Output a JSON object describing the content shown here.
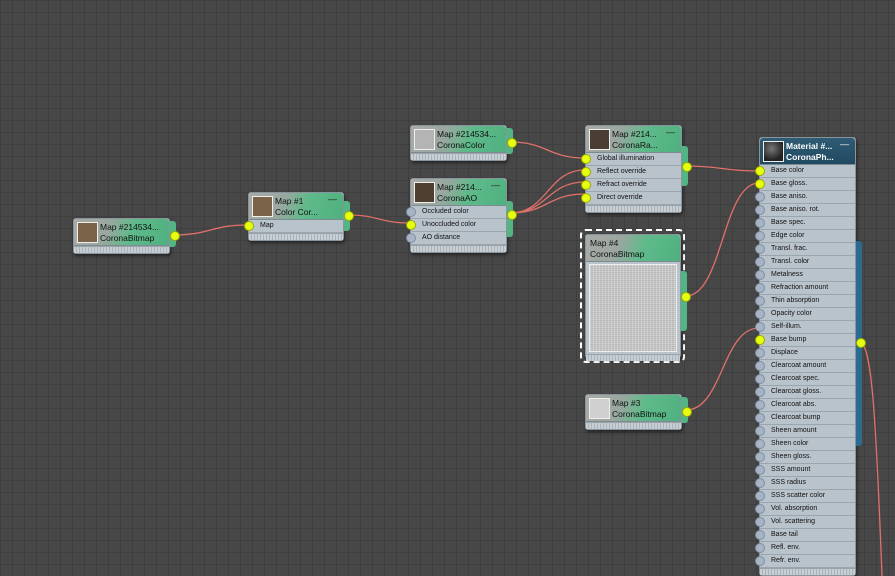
{
  "nodes": {
    "bitmap_a": {
      "title": "Map #214534...",
      "type": "CoronaBitmap",
      "thumb_color": "#7a6348"
    },
    "color_correct": {
      "title": "Map #1",
      "type": "Color Cor...",
      "thumb_color": "#7a6348",
      "inputs": [
        "Map"
      ]
    },
    "corona_color": {
      "title": "Map #214534...",
      "type": "CoronaColor",
      "thumb_color": "#b4b4b4"
    },
    "corona_ao": {
      "title": "Map #214...",
      "type": "CoronaAO",
      "thumb_color": "#4e3f30",
      "inputs": [
        "Occluded color",
        "Unoccluded color",
        "AO distance"
      ]
    },
    "corona_raytrace": {
      "title": "Map #214...",
      "type": "CoronaRa...",
      "thumb_color": "#4a3d33",
      "inputs": [
        "Global illumination",
        "Reflect override",
        "Refract override",
        "Direct override"
      ]
    },
    "bitmap_map4": {
      "title": "Map #4",
      "type": "CoronaBitmap",
      "thumb_color": "#c8c8c8"
    },
    "bitmap_map3": {
      "title": "Map #3",
      "type": "CoronaBitmap",
      "thumb_color": "#d0d0d0"
    },
    "material": {
      "title": "Material #...",
      "type": "CoronaPh...",
      "thumb_color": "#333333",
      "inputs": [
        "Base color",
        "Base gloss.",
        "Base aniso.",
        "Base aniso. rot.",
        "Base spec.",
        "Edge color",
        "Transl. frac.",
        "Transl. color",
        "Metalness",
        "Refraction amount",
        "Thin absorption",
        "Opacity color",
        "Self-illum.",
        "Base bump",
        "Displace",
        "Clearcoat amount",
        "Clearcoat spec.",
        "Clearcoat gloss.",
        "Clearcoat abs.",
        "Clearcoat bump",
        "Sheen amount",
        "Sheen color",
        "Sheen gloss.",
        "SSS amount",
        "SSS radius",
        "SSS scatter color",
        "Vol. absorption",
        "Vol. scattering",
        "Base tail",
        "Refl. env.",
        "Refr. env."
      ],
      "connected_inputs": [
        0,
        1,
        13
      ]
    }
  },
  "colors": {
    "wire": "#e0706a",
    "socket_on": "#e6ff10",
    "accent": "#52b583"
  }
}
